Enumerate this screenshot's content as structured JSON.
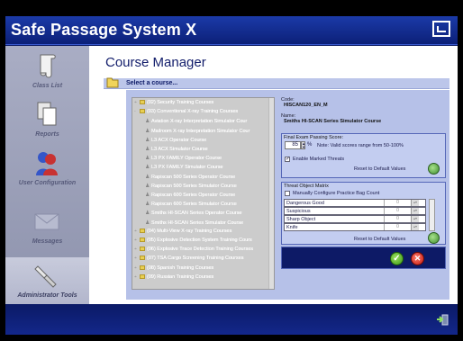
{
  "app": {
    "title": "Safe Passage System X"
  },
  "sidebar": {
    "items": [
      {
        "label": "Class List",
        "icon": "scroll-icon"
      },
      {
        "label": "Reports",
        "icon": "documents-icon"
      },
      {
        "label": "User Configuration",
        "icon": "users-icon"
      },
      {
        "label": "Messages",
        "icon": "envelope-icon"
      },
      {
        "label": "Administrator Tools",
        "icon": "wrench-icon",
        "active": true
      }
    ]
  },
  "main": {
    "title": "Course Manager",
    "select_label": "Select a course...",
    "tree": [
      {
        "label": "(02) Security Training Courses",
        "level": 0,
        "type": "folder",
        "toggle": "+"
      },
      {
        "label": "(03) Conventional X-ray Training Courses",
        "level": 0,
        "type": "folder",
        "toggle": "-"
      },
      {
        "label": "Aviation X-ray Interpretation Simulator Cour",
        "level": 1,
        "type": "course"
      },
      {
        "label": "Mailroom X-ray Interpretation Simulator Cour",
        "level": 1,
        "type": "course"
      },
      {
        "label": "L3 ACX Operator Course",
        "level": 1,
        "type": "course"
      },
      {
        "label": "L3 ACX Simulator Course",
        "level": 1,
        "type": "course"
      },
      {
        "label": "L3 PX FAMILY Operator Course",
        "level": 1,
        "type": "course"
      },
      {
        "label": "L3 PX FAMILY Simulator Course",
        "level": 1,
        "type": "course"
      },
      {
        "label": "Rapiscan 500 Series Operator Course",
        "level": 1,
        "type": "course"
      },
      {
        "label": "Rapiscan 500 Series Simulator Course",
        "level": 1,
        "type": "course"
      },
      {
        "label": "Rapiscan 600 Series Operator Course",
        "level": 1,
        "type": "course"
      },
      {
        "label": "Rapiscan 600 Series Simulator Course",
        "level": 1,
        "type": "course"
      },
      {
        "label": "Smiths HI-SCAN Series Operator Course",
        "level": 1,
        "type": "course"
      },
      {
        "label": "Smiths HI-SCAN Series Simulator Course",
        "level": 1,
        "type": "course"
      },
      {
        "label": "(04) Multi-View X-ray Training Courses",
        "level": 0,
        "type": "folder",
        "toggle": "+"
      },
      {
        "label": "(05) Explosive Detection System Training Cours",
        "level": 0,
        "type": "folder",
        "toggle": "+"
      },
      {
        "label": "(06) Explosive Trace Detection Training Courses",
        "level": 0,
        "type": "folder",
        "toggle": "+"
      },
      {
        "label": "(07) TSA Cargo Screening Training Courses",
        "level": 0,
        "type": "folder",
        "toggle": "+"
      },
      {
        "label": "(08) Spanish Training Courses",
        "level": 0,
        "type": "folder",
        "toggle": "+"
      },
      {
        "label": "(09) Russian Training Courses",
        "level": 0,
        "type": "folder",
        "toggle": "+"
      }
    ],
    "code_label": "Code:",
    "code_value": "HISCAN120_EN_M",
    "name_label": "Name:",
    "name_value": "Smiths HI-SCAN Series Simulator Course",
    "exam": {
      "title": "Final Exam Passing Score:",
      "value": "85",
      "unit": "%",
      "note": "Note: Valid scores range from 50-100%",
      "marked_threats_label": "Enable Marked Threats",
      "marked_threats_checked": true,
      "reset_label": "Reset to Default Values"
    },
    "matrix": {
      "title": "Threat Object Matrix",
      "manual_label": "Manually Configure Practice Bag Count",
      "rows": [
        {
          "name": "Dangerous Good",
          "value": "0"
        },
        {
          "name": "Suspicious",
          "value": "0"
        },
        {
          "name": "Sharp Object",
          "value": "0"
        },
        {
          "name": "Knife",
          "value": "0"
        }
      ],
      "reset_label": "Reset to Default Values"
    },
    "ok_symbol": "✓",
    "cancel_symbol": "✕"
  }
}
